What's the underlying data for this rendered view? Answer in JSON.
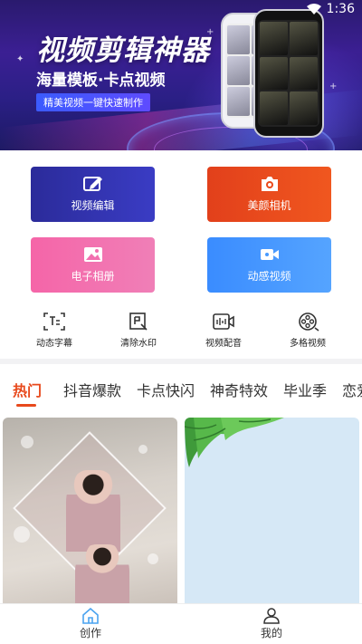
{
  "status_bar": {
    "time": "1:36"
  },
  "banner": {
    "title": "视频剪辑神器",
    "subtitle": "海量模板·卡点视频",
    "tagline": "精美视频一键快速制作"
  },
  "actions": [
    {
      "label": "视频编辑",
      "icon": "edit-icon"
    },
    {
      "label": "美颜相机",
      "icon": "camera-icon"
    },
    {
      "label": "电子相册",
      "icon": "photo-icon"
    },
    {
      "label": "动感视频",
      "icon": "video-camera-icon"
    }
  ],
  "tools": [
    {
      "label": "动态字幕",
      "icon": "subtitle-icon"
    },
    {
      "label": "清除水印",
      "icon": "watermark-icon"
    },
    {
      "label": "视频配音",
      "icon": "dubbing-icon"
    },
    {
      "label": "多格视频",
      "icon": "film-reel-icon"
    }
  ],
  "tabs": [
    "热门",
    "抖音爆款",
    "卡点快闪",
    "神奇特效",
    "毕业季",
    "恋爱"
  ],
  "active_tab": "热门",
  "bottom_nav": [
    {
      "label": "创作",
      "icon": "home-icon",
      "active": true
    },
    {
      "label": "我的",
      "icon": "user-icon",
      "active": false
    }
  ],
  "colors": {
    "accent": "#e8491c",
    "edit_card": "#2f2fa8",
    "camera_card": "#ea4a1c",
    "album_card": "#f270b0",
    "dynamic_card": "#479aff"
  }
}
